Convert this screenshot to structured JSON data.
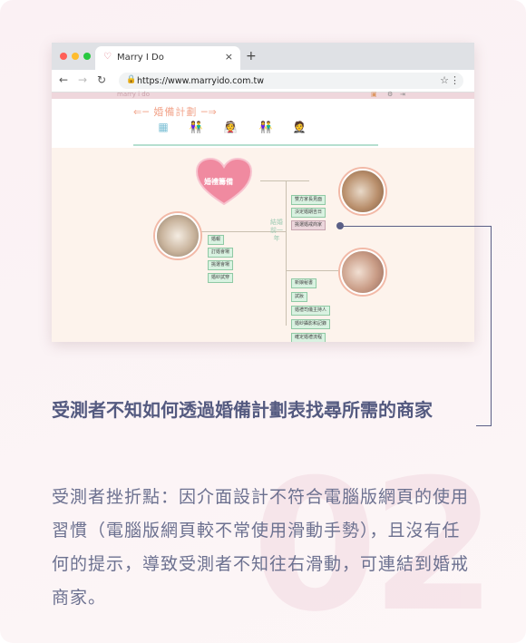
{
  "browser": {
    "tab_title": "Marry I Do",
    "url": "https://www.marryido.com.tw",
    "site_logo": "marry i do"
  },
  "page": {
    "title": "婚備計劃",
    "nav_icons": [
      "calendar-icon",
      "couple-icon",
      "bride-icon",
      "couple-icon",
      "groom-icon"
    ],
    "heart_label": "婚禮籌備",
    "stage_label": "結婚前一年",
    "tags_right_top": [
      "雙方家長見面",
      "決定婚期吉日",
      "挑選婚戒商家"
    ],
    "tags_left": [
      "婚報",
      "訂婚會場",
      "挑選會場",
      "婚紗試穿"
    ],
    "tags_right_bottom": [
      "新娘秘書",
      "試妝",
      "婚禮司儀主持人",
      "婚紗攝影和記錄",
      "確定婚禮流程"
    ]
  },
  "text": {
    "heading": "受測者不知如何透過婚備計劃表找尋所需的商家",
    "body": "受測者挫折點：因介面設計不符合電腦版網頁的使用習慣（電腦版網頁較不常使用滑動手勢），且沒有任何的提示，導致受測者不知往右滑動，可連結到婚戒商家。",
    "watermark": "02"
  },
  "colors": {
    "heading": "#545a80",
    "body": "#6c7190",
    "accent": "#f2a58c"
  }
}
